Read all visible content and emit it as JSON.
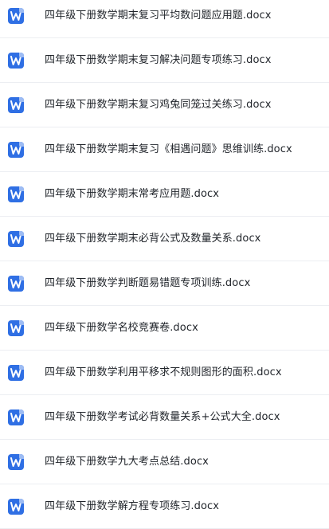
{
  "file_list": {
    "icon": "word-document-icon",
    "icon_color": "#2f6fe4",
    "items": [
      {
        "name": "四年级下册数学期末复习平均数问题应用题.docx"
      },
      {
        "name": "四年级下册数学期末复习解决问题专项练习.docx"
      },
      {
        "name": "四年级下册数学期末复习鸡兔同笼过关练习.docx"
      },
      {
        "name": "四年级下册数学期末复习《相遇问题》思维训练.docx"
      },
      {
        "name": "四年级下册数学期末常考应用题.docx"
      },
      {
        "name": "四年级下册数学期末必背公式及数量关系.docx"
      },
      {
        "name": "四年级下册数学判断题易错题专项训练.docx"
      },
      {
        "name": "四年级下册数学名校竞赛卷.docx"
      },
      {
        "name": "四年级下册数学利用平移求不规则图形的面积.docx"
      },
      {
        "name": "四年级下册数学考试必背数量关系+公式大全.docx"
      },
      {
        "name": "四年级下册数学九大考点总结.docx"
      },
      {
        "name": "四年级下册数学解方程专项练习.docx"
      }
    ]
  }
}
